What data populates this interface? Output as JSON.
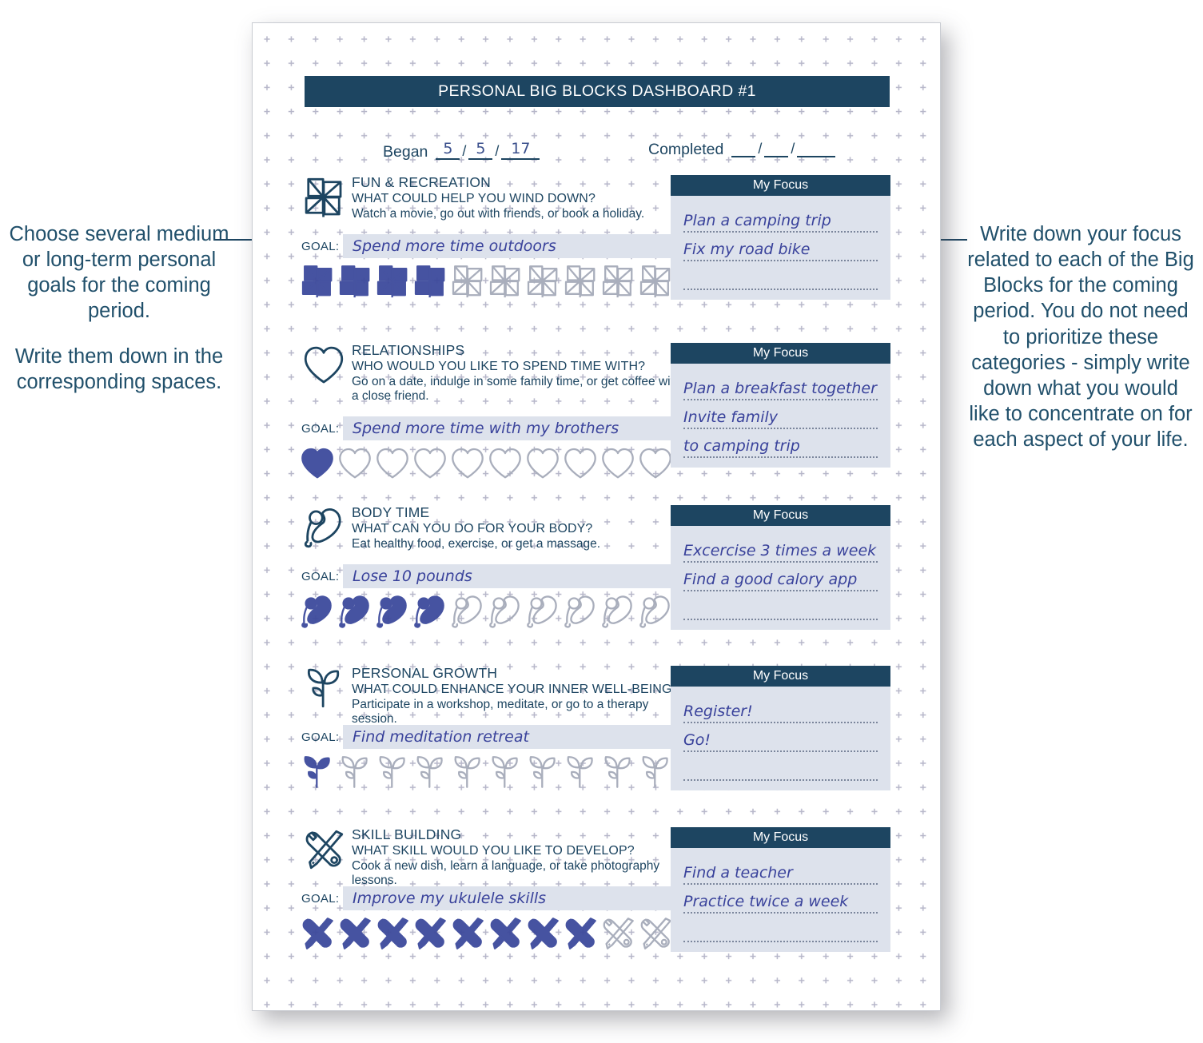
{
  "colors": {
    "navy": "#1d4561",
    "ink": "#39429b",
    "field_fill": "#dde2ec",
    "tick_empty": "#a9aebc",
    "tick_filled": "#3d4a9c"
  },
  "annotations": {
    "left": [
      "Choose several medium or long-term personal goals for the coming period.",
      "Write them down in the corresponding spaces."
    ],
    "right": [
      "Write down your focus related to each of the Big Blocks for the coming period. You do not need to prioritize these categories - simply write down what you would like to concentrate on for each aspect of your life."
    ]
  },
  "page": {
    "title": "PERSONAL BIG BLOCKS DASHBOARD #1",
    "began": {
      "label": "Began",
      "month": "5",
      "day": "5",
      "year": "17",
      "sep": "/"
    },
    "completed": {
      "label": "Completed",
      "month": "",
      "day": "",
      "year": "",
      "sep": "/"
    },
    "goal_label": "GOAL:",
    "focus_header": "My Focus",
    "blocks": [
      {
        "icon": "pinwheel-icon",
        "title": "FUN & RECREATION",
        "question": "WHAT COULD HELP YOU WIND DOWN?",
        "example": "Watch a movie, go out with friends, or book a holiday.",
        "goal": "Spend more time outdoors",
        "ticks_total": 10,
        "ticks_filled": 4,
        "focus": [
          "Plan a camping trip",
          "Fix my road bike",
          ""
        ]
      },
      {
        "icon": "heart-icon",
        "title": "RELATIONSHIPS",
        "question": "WHO WOULD YOU LIKE TO SPEND TIME WITH?",
        "example": "Go on a date, indulge in some family time, or get coffee with a close friend.",
        "goal": "Spend more time with my brothers",
        "ticks_total": 10,
        "ticks_filled": 1,
        "focus": [
          "Plan a breakfast together",
          "Invite family",
          "to camping trip"
        ]
      },
      {
        "icon": "racket-heart-icon",
        "title": "BODY TIME",
        "question": "WHAT CAN YOU DO FOR YOUR BODY?",
        "example": "Eat healthy food, exercise, or get a massage.",
        "goal": "Lose 10 pounds",
        "ticks_total": 10,
        "ticks_filled": 4,
        "focus": [
          "Excercise 3 times a week",
          "Find a good calory app",
          ""
        ]
      },
      {
        "icon": "sprout-icon",
        "title": "PERSONAL GROWTH",
        "question": "WHAT COULD ENHANCE YOUR INNER WELL-BEING?",
        "example": "Participate in a workshop, meditate, or go to a therapy session.",
        "goal": "Find meditation retreat",
        "ticks_total": 10,
        "ticks_filled": 1,
        "focus": [
          "Register!",
          "Go!",
          ""
        ]
      },
      {
        "icon": "tools-icon",
        "title": "SKILL BUILDING",
        "question": "WHAT SKILL WOULD YOU LIKE TO DEVELOP?",
        "example": "Cook a new dish, learn a language, or take photography lessons.",
        "goal": "Improve my ukulele skills",
        "ticks_total": 10,
        "ticks_filled": 8,
        "focus": [
          "Find a teacher",
          "Practice twice a week",
          ""
        ]
      }
    ]
  }
}
